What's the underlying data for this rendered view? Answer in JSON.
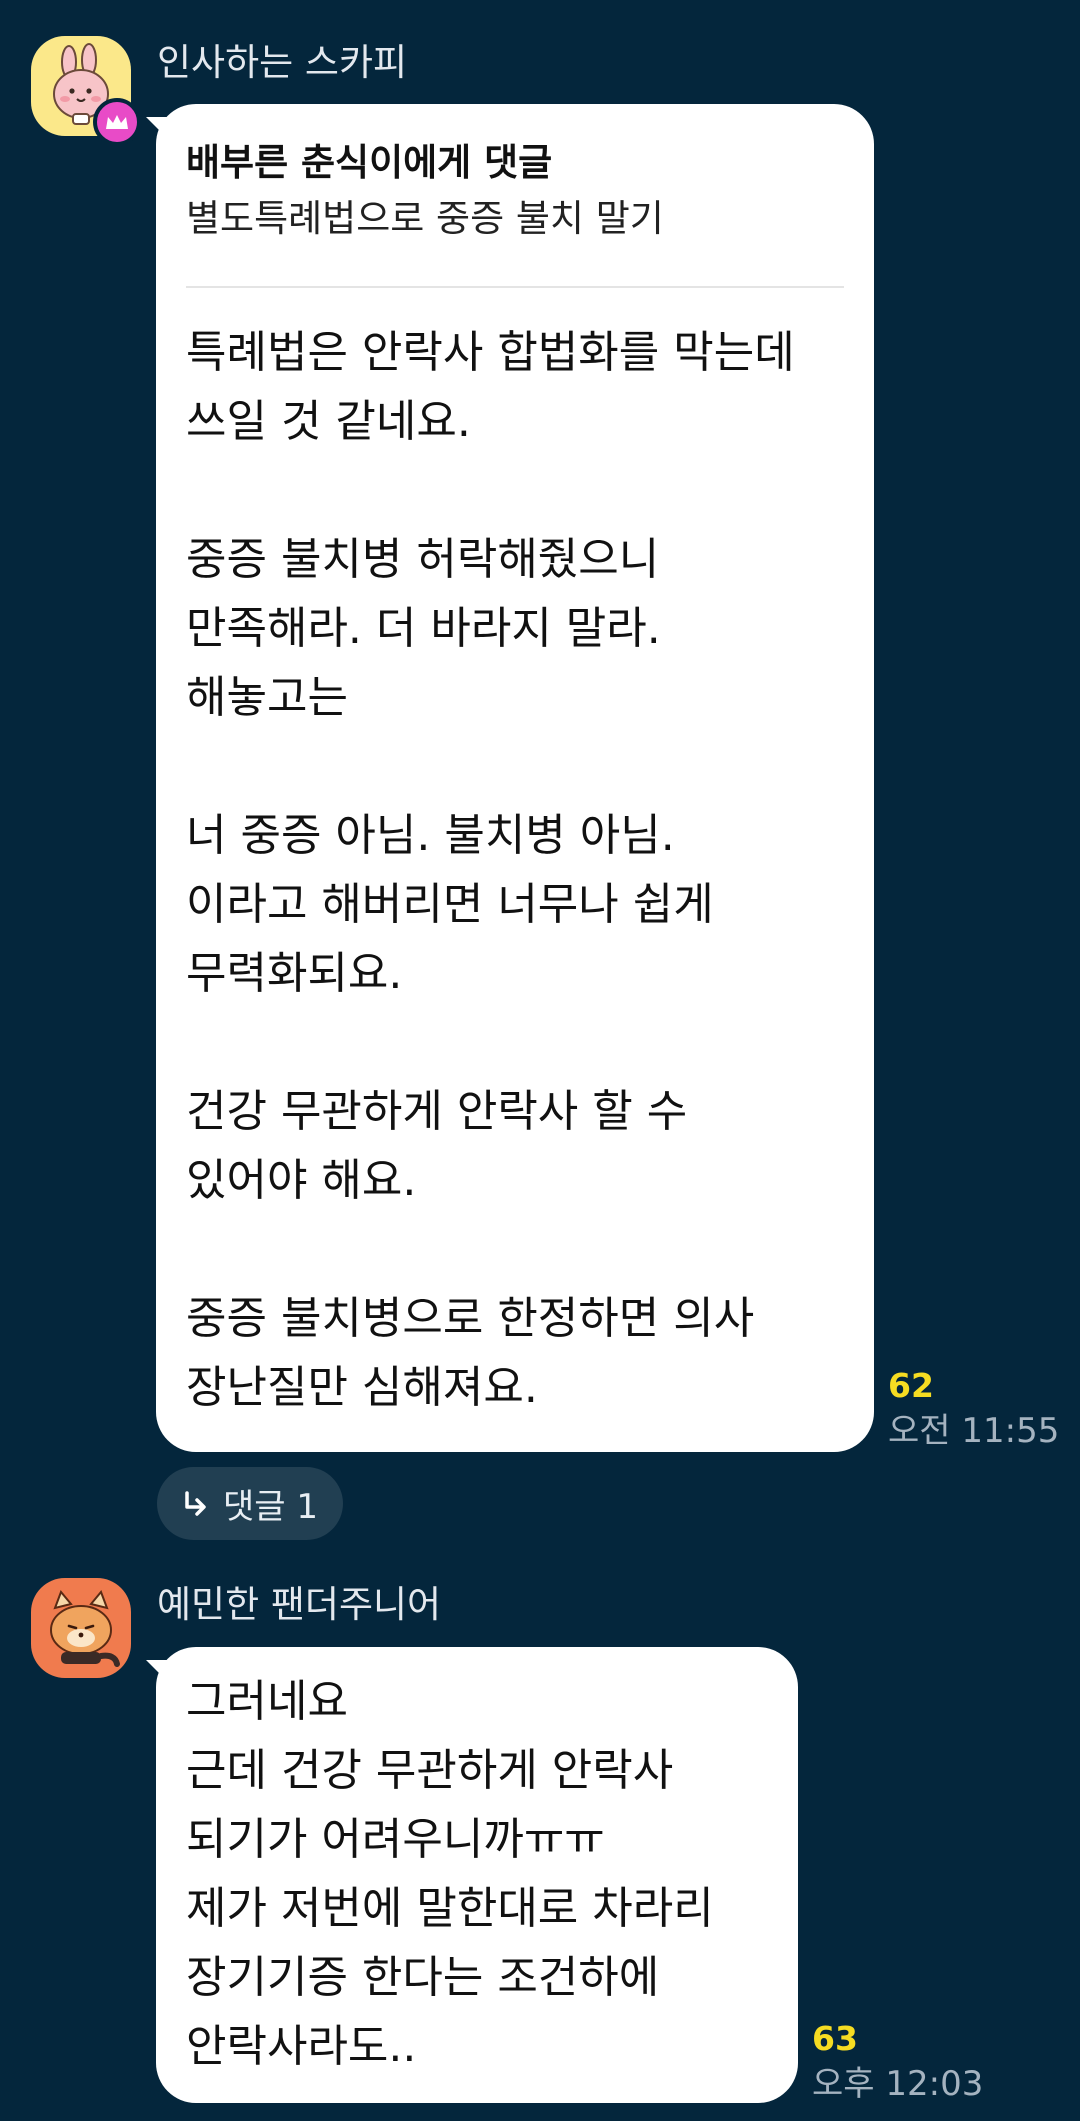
{
  "messages": [
    {
      "sender": "인사하는 스카피",
      "reply_to": {
        "title": "배부른 춘식이에게 댓글",
        "quote": "별도특례법으로 중증 불치 말기"
      },
      "text": "특례법은 안락사 합법화를 막는데\n쓰일 것 같네요.\n\n중증 불치병 허락해줬으니\n만족해라. 더 바라지 말라.\n해놓고는\n\n너 중증 아님. 불치병 아님.\n이라고 해버리면 너무나 쉽게\n무력화되요.\n\n건강 무관하게 안락사 할 수\n있어야 해요.\n\n중증 불치병으로 한정하면 의사\n장난질만 심해져요.",
      "unread_count": "62",
      "time": "오전 11:55",
      "thread_label": "댓글 1"
    },
    {
      "sender": "예민한 팬더주니어",
      "text": "그러네요\n근데 건강 무관하게 안락사\n되기가 어려우니까ㅠㅠ\n제가 저번에 말한대로 차라리\n장기기증 한다는 조건하에\n안락사라도..",
      "unread_count": "63",
      "time": "오후 12:03"
    }
  ],
  "icons": {
    "avatar_1": "pink-rabbit-character-icon",
    "crown_badge": "crown-icon",
    "avatar_2": "red-panda-character-icon",
    "thread": "reply-arrow-icon"
  },
  "colors": {
    "background": "#04263c",
    "bubble": "#ffffff",
    "unread": "#f6dc22",
    "crown_badge": "#e84bc7",
    "avatar_1_bg": "#fbe88a",
    "avatar_2_bg": "#f07b4e"
  }
}
